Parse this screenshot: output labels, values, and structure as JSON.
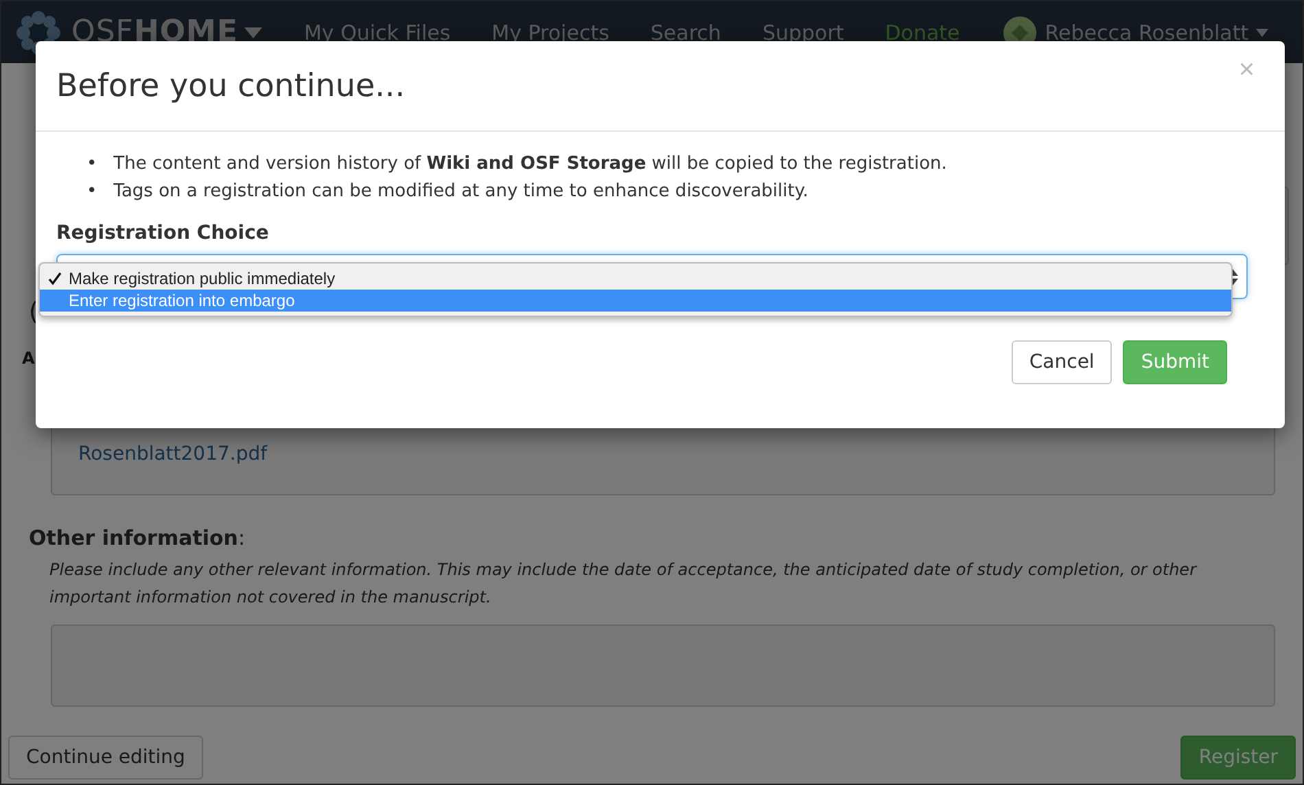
{
  "navbar": {
    "brand_light": "OSF",
    "brand_bold": "HOME",
    "links": [
      {
        "label": "My Quick Files",
        "kind": "plain"
      },
      {
        "label": "My Projects",
        "kind": "plain"
      },
      {
        "label": "Search",
        "kind": "plain"
      },
      {
        "label": "Support",
        "kind": "plain"
      },
      {
        "label": "Donate",
        "kind": "donate"
      }
    ],
    "user": "Rebecca Rosenblatt"
  },
  "page": {
    "fragments": [
      "(",
      "A"
    ],
    "file_link": "Rosenblatt2017.pdf",
    "other_label": "Other information",
    "other_colon": ":",
    "other_help": "Please include any other relevant information. This may include the date of acceptance, the anticipated date of study completion, or other important information not covered in the manuscript.",
    "buttons": [
      {
        "label": "Continue editing",
        "kind": "default"
      },
      {
        "label": "Register",
        "kind": "success"
      }
    ]
  },
  "modal": {
    "title": "Before you continue...",
    "close": "×",
    "bullets": [
      {
        "marker": "•",
        "text": "The content and version history of **Wiki and OSF Storage** will be copied to the registration."
      },
      {
        "marker": "•",
        "text": "Tags on a registration can be modified at any time to enhance discoverability."
      }
    ],
    "field_label": "Registration Choice",
    "options": [
      {
        "label": "Make registration public immediately",
        "checked": true,
        "selected": false
      },
      {
        "label": "Enter registration into embargo",
        "checked": false,
        "selected": true
      }
    ],
    "buttons": [
      {
        "label": "Cancel",
        "kind": "default"
      },
      {
        "label": "Submit",
        "kind": "success"
      }
    ]
  }
}
